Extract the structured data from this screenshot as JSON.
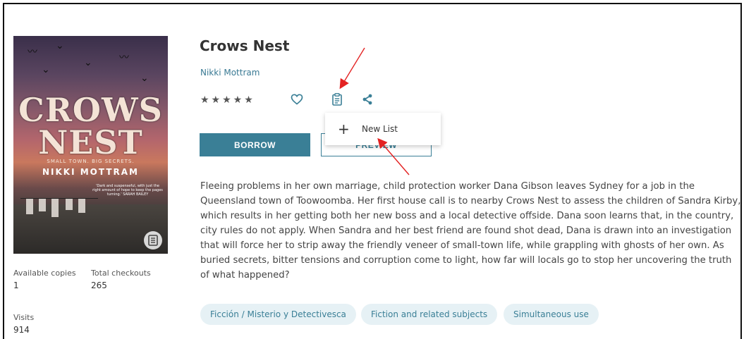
{
  "book": {
    "title": "Crows Nest",
    "author": "Nikki Mottram",
    "rating_stars": "★★★★★",
    "borrow_label": "BORROW",
    "preview_label": "PREVIEW",
    "description": "Fleeing problems in her own marriage, child protection worker Dana Gibson leaves Sydney for a job in the Queensland town of Toowoomba. Her first house call is to nearby Crows Nest to assess the children of Sandra Kirby, which results in her getting both her new boss and a local detective offside. Dana soon learns that, in the country, city rules do not apply. When Sandra and her best friend are found shot dead, Dana is drawn into an investigation that will force her to strip away the friendly veneer of small-town life, while grappling with ghosts of her own. As buried secrets, bitter tensions and corruption come to light, how far will locals go to stop her uncovering the truth of what happened?",
    "tags": [
      "Ficción / Misterio y Detectivesca",
      "Fiction and related subjects",
      "Simultaneous use"
    ]
  },
  "cover": {
    "title_line1": "CROWS",
    "title_line2": "NEST",
    "tagline": "SMALL TOWN. BIG SECRETS.",
    "author": "NIKKI MOTTRAM",
    "quote": "'Dark and suspenseful, with just the right amount of hope to keep the pages turning.' SARAH BAILEY"
  },
  "stats": {
    "available_label": "Available copies",
    "available_value": "1",
    "checkouts_label": "Total checkouts",
    "checkouts_value": "265",
    "visits_label": "Visits",
    "visits_value": "914"
  },
  "list_menu": {
    "plus": "+",
    "new_list_label": "New List"
  },
  "icons": {
    "favorite": "heart-icon",
    "add_to_list": "clipboard-icon",
    "share": "share-icon",
    "cover_badge": "book-icon"
  },
  "colors": {
    "accent": "#3a7f96",
    "chip_bg": "#e6f1f5",
    "annotation": "#e32222"
  }
}
